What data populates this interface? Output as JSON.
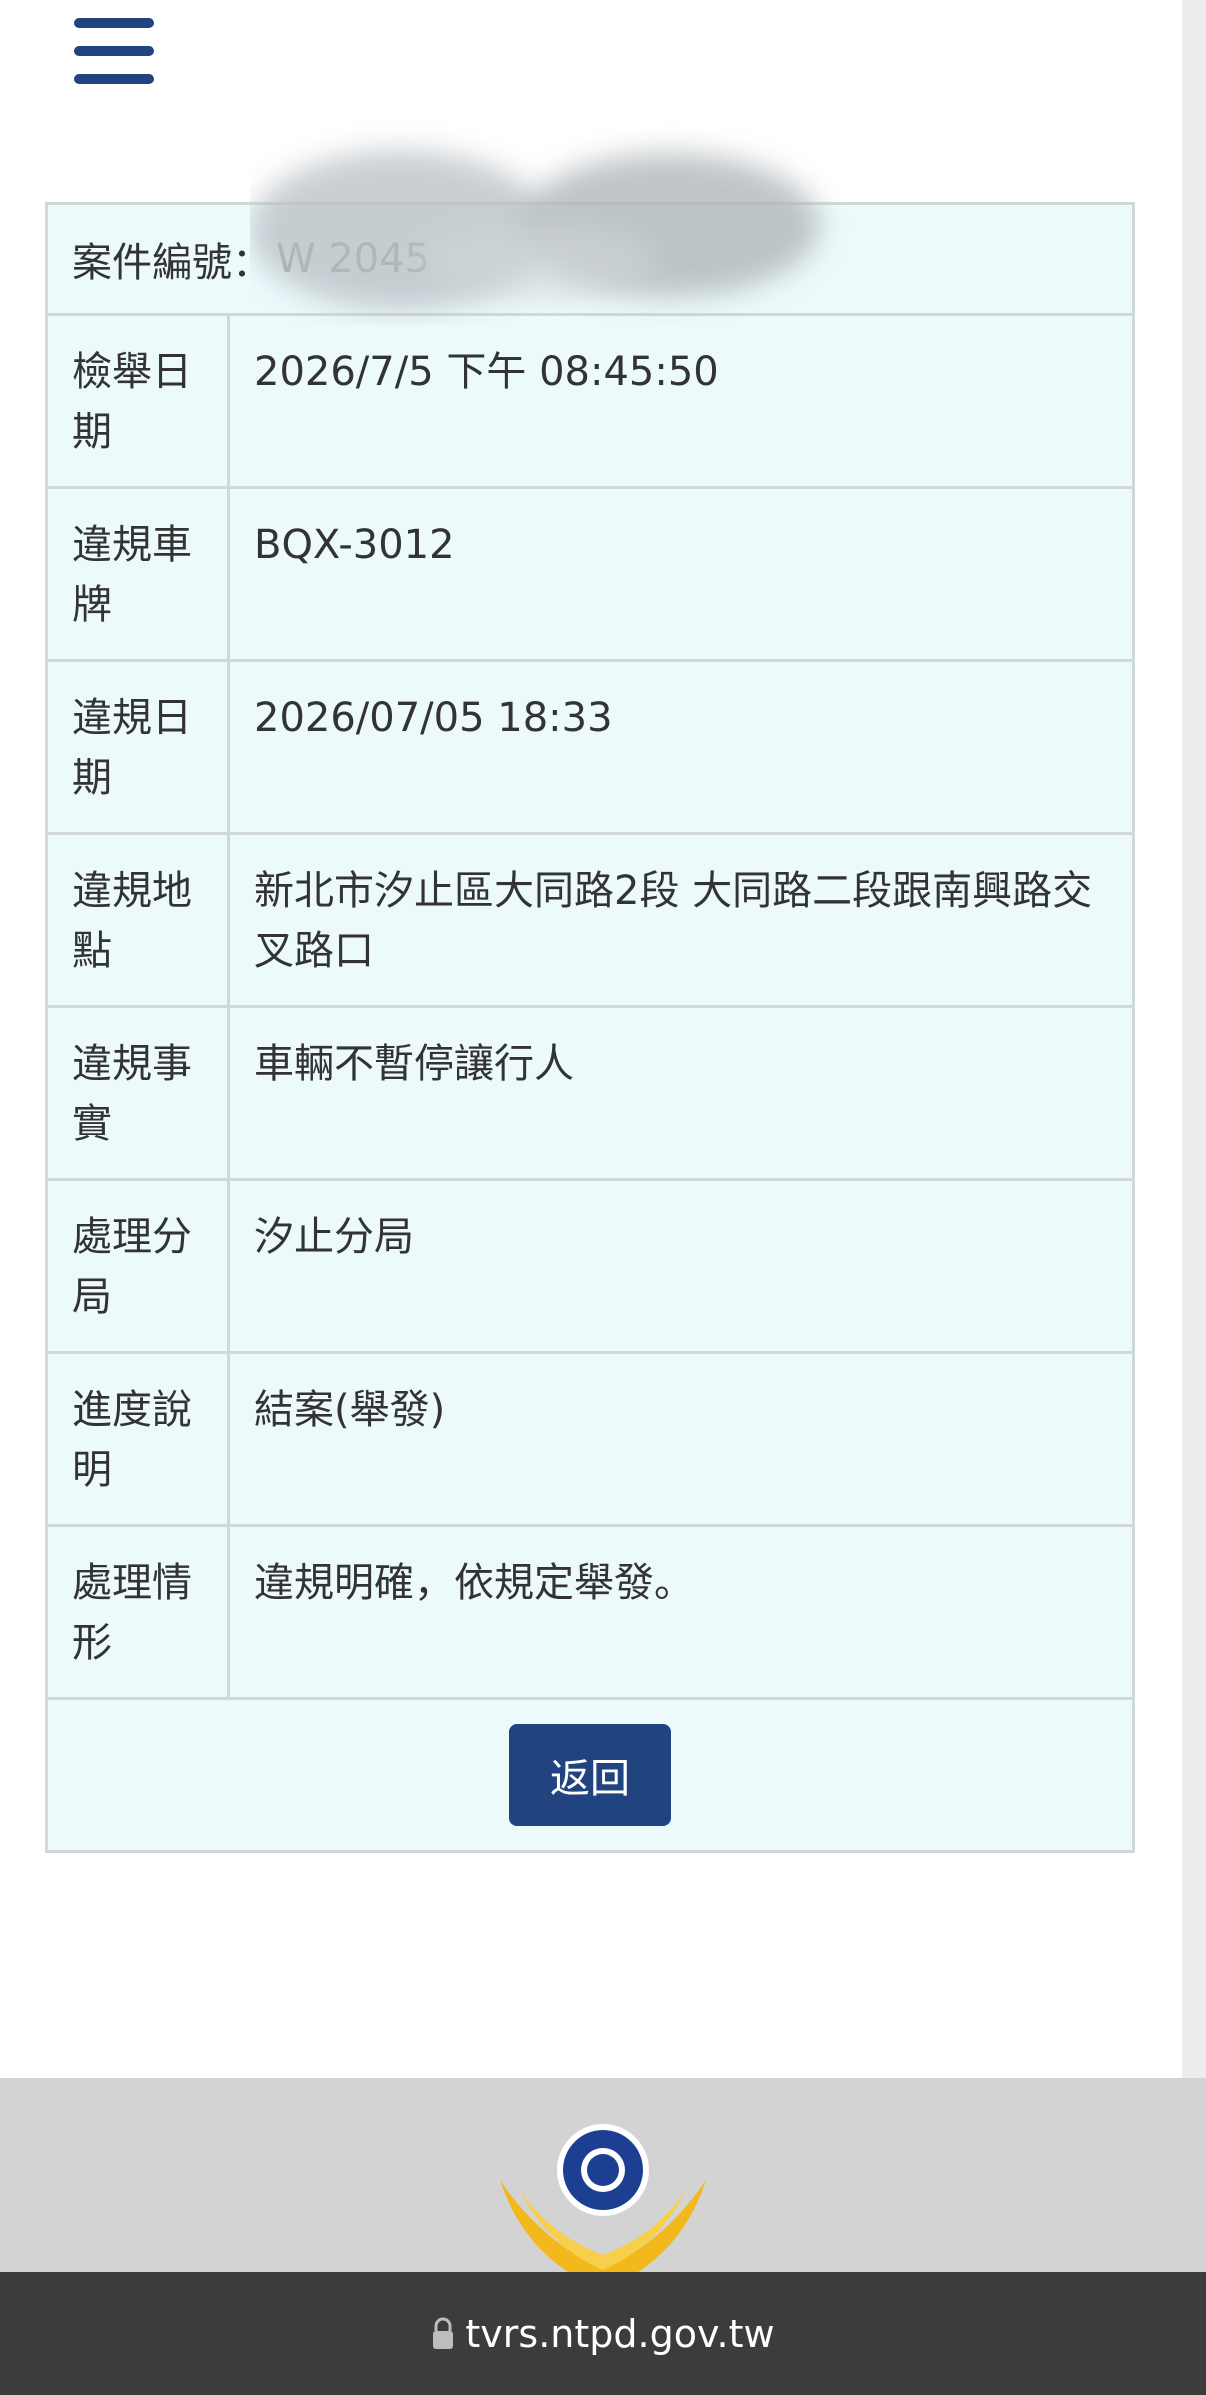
{
  "case": {
    "label": "案件編號：",
    "value": "W      2045"
  },
  "rows": [
    {
      "label": "檢舉日期",
      "value": "2026/7/5 下午 08:45:50"
    },
    {
      "label": "違規車牌",
      "value": "BQX-3012"
    },
    {
      "label": "違規日期",
      "value": "2026/07/05 18:33"
    },
    {
      "label": "違規地點",
      "value": "新北市汐止區大同路2段 大同路二段跟南興路交叉路口"
    },
    {
      "label": "違規事實",
      "value": "車輛不暫停讓行人"
    },
    {
      "label": "處理分局",
      "value": "汐止分局"
    },
    {
      "label": "進度說明",
      "value": "結案(舉發)"
    },
    {
      "label": "處理情形",
      "value": "違規明確，依規定舉發。"
    }
  ],
  "back_button": "返回",
  "url": "tvrs.ntpd.gov.tw",
  "colors": {
    "primary": "#21437f",
    "card_bg": "#ecfafc",
    "border": "#d2d8d9",
    "footer_bg": "#d3d3d3",
    "url_bar_bg": "#3c3c3c"
  },
  "icons": [
    "menu-icon",
    "lock-icon",
    "police-emblem"
  ]
}
